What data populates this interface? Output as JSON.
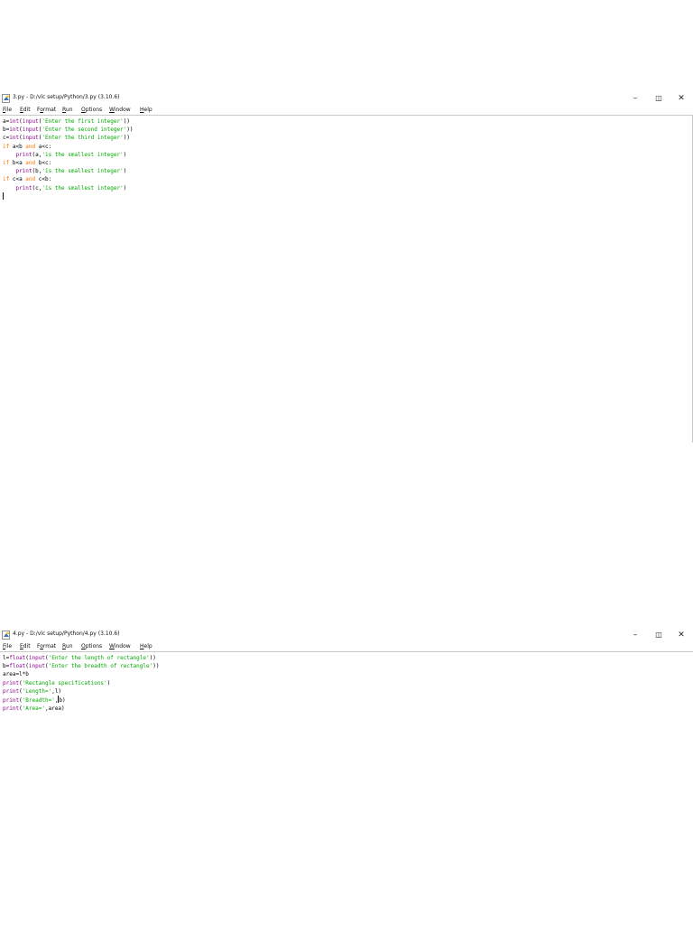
{
  "windows": [
    {
      "title": "3.py - D:/vlc setup/Python/3.py (3.10.6)",
      "controls": {
        "minimize": "–",
        "maximize": "◫",
        "close": "✕"
      },
      "menu": [
        {
          "pre": "",
          "u": "F",
          "post": "ile"
        },
        {
          "pre": "",
          "u": "E",
          "post": "dit"
        },
        {
          "pre": "F",
          "u": "o",
          "post": "rmat"
        },
        {
          "pre": "",
          "u": "R",
          "post": "un"
        },
        {
          "pre": "",
          "u": "O",
          "post": "ptions"
        },
        {
          "pre": "",
          "u": "W",
          "post": "indow"
        },
        {
          "pre": "",
          "u": "H",
          "post": "elp"
        }
      ],
      "code": [
        [
          [
            "",
            "a="
          ],
          [
            "bi",
            "int"
          ],
          [
            "",
            "("
          ],
          [
            "bi",
            "input"
          ],
          [
            "",
            "("
          ],
          [
            "st",
            "'Enter the first integer'"
          ],
          [
            "",
            "))"
          ]
        ],
        [
          [
            "",
            "b="
          ],
          [
            "bi",
            "int"
          ],
          [
            "",
            "("
          ],
          [
            "bi",
            "input"
          ],
          [
            "",
            "("
          ],
          [
            "st",
            "'Enter the second integer'"
          ],
          [
            "",
            "))"
          ]
        ],
        [
          [
            "",
            "c="
          ],
          [
            "bi",
            "int"
          ],
          [
            "",
            "("
          ],
          [
            "bi",
            "input"
          ],
          [
            "",
            "("
          ],
          [
            "st",
            "'Enter the third integer'"
          ],
          [
            "",
            "))"
          ]
        ],
        [
          [
            "kw",
            "if"
          ],
          [
            "",
            " a<b "
          ],
          [
            "kw",
            "and"
          ],
          [
            "",
            " a<c:"
          ]
        ],
        [
          [
            "",
            "    "
          ],
          [
            "bi",
            "print"
          ],
          [
            "",
            "(a,"
          ],
          [
            "st",
            "'is the smallest integer'"
          ],
          [
            "",
            ")"
          ]
        ],
        [
          [
            "kw",
            "if"
          ],
          [
            "",
            " b<a "
          ],
          [
            "kw",
            "and"
          ],
          [
            "",
            " b<c:"
          ]
        ],
        [
          [
            "",
            "    "
          ],
          [
            "bi",
            "print"
          ],
          [
            "",
            "(b,"
          ],
          [
            "st",
            "'is the smallest integer'"
          ],
          [
            "",
            ")"
          ]
        ],
        [
          [
            "kw",
            "if"
          ],
          [
            "",
            " c<a "
          ],
          [
            "kw",
            "and"
          ],
          [
            "",
            " c<b:"
          ]
        ],
        [
          [
            "",
            "    "
          ],
          [
            "bi",
            "print"
          ],
          [
            "",
            "(c,"
          ],
          [
            "st",
            "'is the smallest integer'"
          ],
          [
            "",
            ")"
          ]
        ]
      ]
    },
    {
      "title": "4.py - D:/vlc setup/Python/4.py (3.10.6)",
      "controls": {
        "minimize": "–",
        "maximize": "◫",
        "close": "✕"
      },
      "menu": [
        {
          "pre": "",
          "u": "F",
          "post": "ile"
        },
        {
          "pre": "",
          "u": "E",
          "post": "dit"
        },
        {
          "pre": "F",
          "u": "o",
          "post": "rmat"
        },
        {
          "pre": "",
          "u": "R",
          "post": "un"
        },
        {
          "pre": "",
          "u": "O",
          "post": "ptions"
        },
        {
          "pre": "",
          "u": "W",
          "post": "indow"
        },
        {
          "pre": "",
          "u": "H",
          "post": "elp"
        }
      ],
      "code": [
        [
          [
            "",
            "l="
          ],
          [
            "bi",
            "float"
          ],
          [
            "",
            "("
          ],
          [
            "bi",
            "input"
          ],
          [
            "",
            "("
          ],
          [
            "st",
            "'Enter the length of rectangle'"
          ],
          [
            "",
            "))"
          ]
        ],
        [
          [
            "",
            "b="
          ],
          [
            "bi",
            "float"
          ],
          [
            "",
            "("
          ],
          [
            "bi",
            "input"
          ],
          [
            "",
            "("
          ],
          [
            "st",
            "'Enter the breadth of rectangle'"
          ],
          [
            "",
            "))"
          ]
        ],
        [
          [
            "",
            "area=l*b"
          ]
        ],
        [
          [
            "bi",
            "print"
          ],
          [
            "",
            "("
          ],
          [
            "st",
            "'Rectangle specifications'"
          ],
          [
            "",
            ")"
          ]
        ],
        [
          [
            "bi",
            "print"
          ],
          [
            "",
            "("
          ],
          [
            "st",
            "'Length='"
          ],
          [
            "",
            ",l)"
          ]
        ],
        [
          [
            "bi",
            "print"
          ],
          [
            "",
            "("
          ],
          [
            "st",
            "'Breadth='"
          ],
          [
            "",
            ",b)"
          ]
        ],
        [
          [
            "bi",
            "print"
          ],
          [
            "",
            "("
          ],
          [
            "st",
            "'Area='"
          ],
          [
            "",
            ",area)"
          ]
        ]
      ]
    }
  ]
}
